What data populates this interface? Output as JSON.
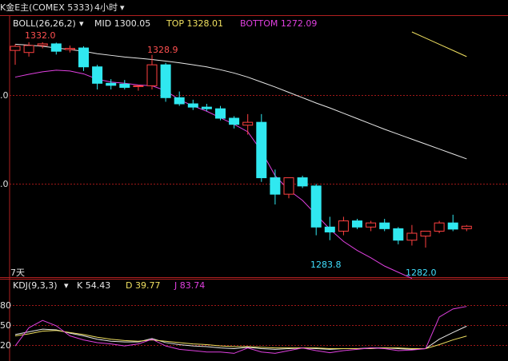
{
  "header": {
    "symbol": "K金E主(COMEX 5333)",
    "period": "4小时",
    "period_arrow": "▾"
  },
  "boll": {
    "name": "BOLL(26,26,2)",
    "mid_label": "MID 1300.05",
    "top_label": "TOP 1328.01",
    "bottom_label": "BOTTOM 1272.09",
    "colors": {
      "name": "#e8e8e8",
      "mid": "#e8e8e8",
      "top": "#f0e060",
      "bottom": "#e040e0"
    }
  },
  "kdj": {
    "name": "KDJ(9,3,3)",
    "k_label": "K 54.43",
    "d_label": "D 39.77",
    "j_label": "J 83.74",
    "colors": {
      "k": "#e8e8e8",
      "d": "#f0e060",
      "j": "#e040e0"
    }
  },
  "annotations": {
    "high1": "1332.0",
    "high2": "1328.9",
    "low1": "1283.8",
    "low2": "1282.0",
    "days": "7天"
  },
  "axis": {
    "price_ticks": [
      ".0",
      ".0"
    ],
    "kdj_ticks": [
      "80",
      "50",
      "20"
    ]
  },
  "chart_data": [
    {
      "type": "candlestick",
      "title": "BOLL(26,26,2)",
      "ylim": [
        1275,
        1338
      ],
      "candles": [
        {
          "o": 1330.0,
          "h": 1331.5,
          "l": 1326.5,
          "c": 1331.0
        },
        {
          "o": 1329.5,
          "h": 1332.0,
          "l": 1328.5,
          "c": 1331.2
        },
        {
          "o": 1331.2,
          "h": 1332.0,
          "l": 1330.5,
          "c": 1331.6
        },
        {
          "o": 1331.6,
          "h": 1331.9,
          "l": 1329.0,
          "c": 1329.8
        },
        {
          "o": 1330.2,
          "h": 1331.2,
          "l": 1329.5,
          "c": 1330.5
        },
        {
          "o": 1330.6,
          "h": 1331.0,
          "l": 1325.0,
          "c": 1326.0
        },
        {
          "o": 1326.0,
          "h": 1326.5,
          "l": 1320.5,
          "c": 1322.0
        },
        {
          "o": 1322.0,
          "h": 1323.0,
          "l": 1320.5,
          "c": 1321.5
        },
        {
          "o": 1321.8,
          "h": 1322.8,
          "l": 1320.5,
          "c": 1321.0
        },
        {
          "o": 1321.2,
          "h": 1321.6,
          "l": 1320.2,
          "c": 1321.4
        },
        {
          "o": 1321.4,
          "h": 1328.9,
          "l": 1320.5,
          "c": 1326.5
        },
        {
          "o": 1326.5,
          "h": 1327.0,
          "l": 1317.5,
          "c": 1318.5
        },
        {
          "o": 1318.5,
          "h": 1320.0,
          "l": 1316.5,
          "c": 1317.0
        },
        {
          "o": 1317.0,
          "h": 1318.0,
          "l": 1315.5,
          "c": 1316.2
        },
        {
          "o": 1316.2,
          "h": 1317.0,
          "l": 1315.2,
          "c": 1315.8
        },
        {
          "o": 1315.8,
          "h": 1316.5,
          "l": 1313.0,
          "c": 1313.5
        },
        {
          "o": 1313.5,
          "h": 1314.0,
          "l": 1311.0,
          "c": 1312.0
        },
        {
          "o": 1311.8,
          "h": 1314.5,
          "l": 1309.5,
          "c": 1312.5
        },
        {
          "o": 1312.5,
          "h": 1314.5,
          "l": 1298.0,
          "c": 1299.0
        },
        {
          "o": 1299.0,
          "h": 1301.0,
          "l": 1292.5,
          "c": 1295.0
        },
        {
          "o": 1295.0,
          "h": 1299.0,
          "l": 1294.0,
          "c": 1299.0
        },
        {
          "o": 1299.0,
          "h": 1299.5,
          "l": 1296.5,
          "c": 1297.0
        },
        {
          "o": 1297.0,
          "h": 1297.5,
          "l": 1285.0,
          "c": 1287.0
        },
        {
          "o": 1287.0,
          "h": 1289.5,
          "l": 1283.8,
          "c": 1285.8
        },
        {
          "o": 1286.0,
          "h": 1289.5,
          "l": 1285.0,
          "c": 1288.5
        },
        {
          "o": 1288.5,
          "h": 1289.0,
          "l": 1286.5,
          "c": 1287.0
        },
        {
          "o": 1287.0,
          "h": 1288.5,
          "l": 1286.0,
          "c": 1288.0
        },
        {
          "o": 1288.0,
          "h": 1289.0,
          "l": 1286.0,
          "c": 1286.6
        },
        {
          "o": 1286.6,
          "h": 1287.0,
          "l": 1282.8,
          "c": 1283.8
        },
        {
          "o": 1283.8,
          "h": 1287.5,
          "l": 1282.5,
          "c": 1285.5
        },
        {
          "o": 1284.8,
          "h": 1286.0,
          "l": 1282.0,
          "c": 1286.0
        },
        {
          "o": 1286.0,
          "h": 1288.5,
          "l": 1285.5,
          "c": 1288.0
        },
        {
          "o": 1288.0,
          "h": 1290.0,
          "l": 1286.0,
          "c": 1286.5
        },
        {
          "o": 1286.6,
          "h": 1287.5,
          "l": 1286.0,
          "c": 1287.2
        }
      ],
      "mid": [
        1331.5,
        1331.3,
        1331.0,
        1330.6,
        1330.2,
        1329.8,
        1329.2,
        1328.8,
        1328.4,
        1328.1,
        1327.8,
        1327.4,
        1327.0,
        1326.5,
        1326.0,
        1325.3,
        1324.5,
        1323.5,
        1322.3,
        1321.1,
        1319.8,
        1318.5,
        1317.2,
        1316.0,
        1314.7,
        1313.4,
        1312.1,
        1310.8,
        1309.6,
        1308.4,
        1307.2,
        1306.0,
        1304.8,
        1303.6
      ],
      "upper_visible": [
        1334.5,
        1333.0,
        1331.5,
        1330.0,
        1328.5
      ],
      "lower": [
        1323.5,
        1324.2,
        1324.8,
        1325.2,
        1325.0,
        1324.3,
        1323.0,
        1322.3,
        1322.0,
        1321.6,
        1321.4,
        1320.2,
        1318.0,
        1316.5,
        1315.2,
        1313.6,
        1312.0,
        1310.2,
        1305.5,
        1299.5,
        1296.0,
        1293.5,
        1290.0,
        1286.5,
        1283.5,
        1281.3,
        1279.5,
        1277.5,
        1276.0,
        1274.5
      ]
    },
    {
      "type": "line",
      "title": "KDJ(9,3,3)",
      "ylim": [
        5,
        100
      ],
      "series": [
        {
          "name": "K",
          "values": [
            42,
            46,
            50,
            49,
            44,
            40,
            35,
            32,
            31,
            31,
            36,
            30,
            27,
            25,
            24,
            22,
            21,
            23,
            21,
            20,
            21,
            22,
            21,
            20,
            21,
            21,
            22,
            22,
            21,
            20,
            21,
            35,
            45,
            54.43
          ]
        },
        {
          "name": "D",
          "values": [
            40,
            43,
            47,
            48,
            45,
            42,
            38,
            35,
            33,
            32,
            34,
            32,
            30,
            28,
            27,
            25,
            24,
            24,
            23,
            22,
            22,
            22,
            22,
            21,
            21,
            21,
            21,
            22,
            22,
            21,
            21,
            27,
            34,
            39.77
          ]
        },
        {
          "name": "J",
          "values": [
            25,
            52,
            63,
            55,
            40,
            34,
            30,
            28,
            25,
            28,
            35,
            25,
            20,
            18,
            16,
            16,
            14,
            22,
            16,
            14,
            18,
            22,
            18,
            15,
            18,
            20,
            22,
            21,
            18,
            19,
            21,
            68,
            80,
            83.74
          ]
        }
      ]
    }
  ]
}
